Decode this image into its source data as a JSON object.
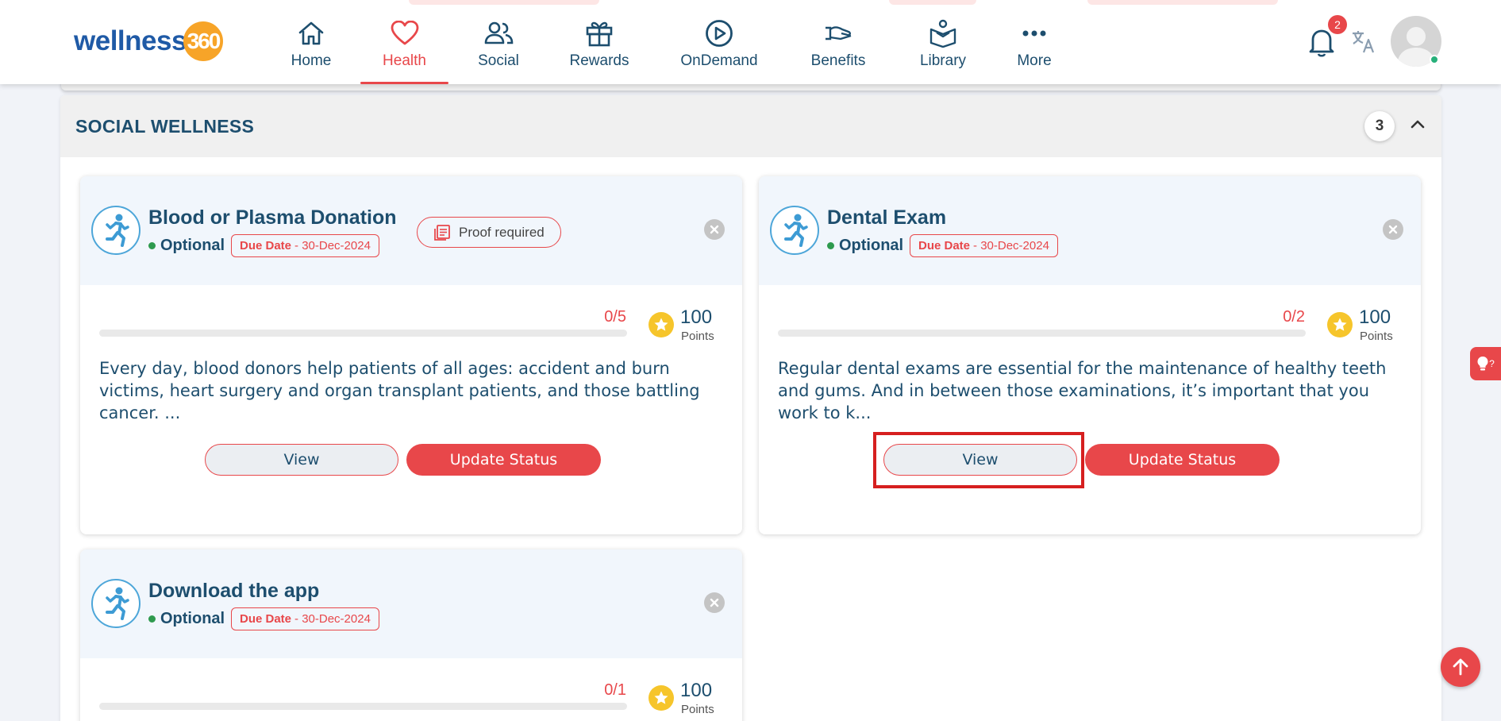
{
  "header": {
    "logo_text": "wellness",
    "logo_number": "360",
    "nav": [
      {
        "label": "Home",
        "icon": "home-icon"
      },
      {
        "label": "Health",
        "icon": "heart-icon",
        "active": true
      },
      {
        "label": "Social",
        "icon": "people-icon"
      },
      {
        "label": "Rewards",
        "icon": "gift-icon"
      },
      {
        "label": "OnDemand",
        "icon": "play-circle-icon"
      },
      {
        "label": "Benefits",
        "icon": "hand-benefits-icon"
      },
      {
        "label": "Library",
        "icon": "library-icon"
      },
      {
        "label": "More",
        "icon": "more-dots-icon"
      }
    ],
    "notifications_count": "2",
    "accent_color": "#e8474a"
  },
  "section": {
    "title": "SOCIAL WELLNESS",
    "count": "3"
  },
  "cards": [
    {
      "title": "Blood or Plasma Donation",
      "status": "Optional",
      "due_label": "Due Date",
      "due_value": " - 30-Dec-2024",
      "proof": "Proof required",
      "progress": "0/5",
      "progress_fraction": 0,
      "points": "100",
      "points_label": "Points",
      "description": "Every day, blood donors help patients of all ages: accident and burn victims, heart surgery and organ transplant patients, and those battling cancer. ...",
      "view_label": "View",
      "update_label": "Update Status"
    },
    {
      "title": "Dental Exam",
      "status": "Optional",
      "due_label": "Due Date",
      "due_value": " - 30-Dec-2024",
      "progress": "0/2",
      "progress_fraction": 0,
      "points": "100",
      "points_label": "Points",
      "description": "Regular dental exams are essential for the maintenance of healthy teeth and gums. And in between those examinations, it’s important that you work to k...",
      "view_label": "View",
      "update_label": "Update Status"
    },
    {
      "title": "Download the app",
      "status": "Optional",
      "due_label": "Due Date",
      "due_value": " - 30-Dec-2024",
      "progress": "0/1",
      "progress_fraction": 0,
      "points": "100",
      "points_label": "Points"
    }
  ],
  "help_tab_text": "?"
}
